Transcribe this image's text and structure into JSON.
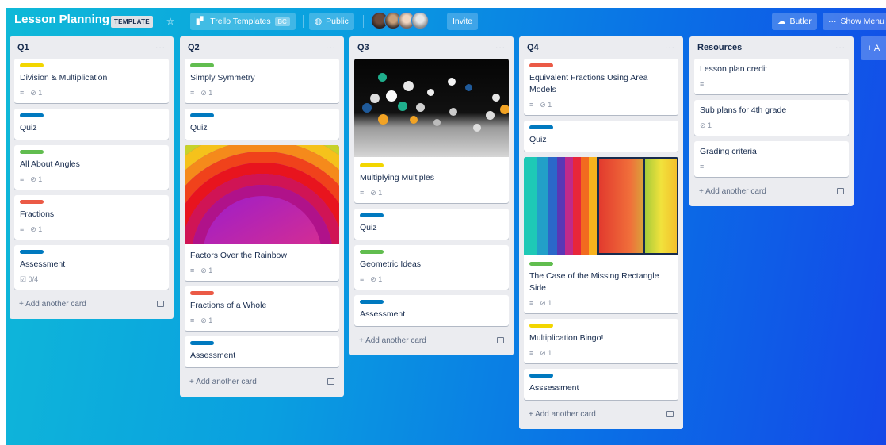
{
  "board": {
    "title": "Lesson Planning",
    "template_badge": "TEMPLATE",
    "workspace_label": "Trello Templates",
    "workspace_badge": "BC",
    "visibility_label": "Public",
    "invite_label": "Invite",
    "butler_label": "Butler",
    "show_menu_label": "Show Menu",
    "add_list_label": "+ A"
  },
  "lists": [
    {
      "title": "Q1",
      "menu": "···",
      "add_card": "+ Add another card",
      "cards": [
        {
          "label_color": "#f2d600",
          "title": "Division & Multiplication",
          "desc": "≡",
          "attach": "⊘ 1"
        },
        {
          "label_color": "#0079bf",
          "title": "Quiz"
        },
        {
          "label_color": "#61bd4f",
          "title": "All About Angles",
          "desc": "≡",
          "attach": "⊘ 1"
        },
        {
          "label_color": "#eb5a46",
          "title": "Fractions",
          "desc": "≡",
          "attach": "⊘ 1"
        },
        {
          "label_color": "#0079bf",
          "title": "Assessment",
          "checklist": "☑ 0/4"
        }
      ]
    },
    {
      "title": "Q2",
      "menu": "···",
      "add_card": "+ Add another card",
      "cards": [
        {
          "label_color": "#61bd4f",
          "title": "Simply Symmetry",
          "desc": "≡",
          "attach": "⊘ 1"
        },
        {
          "label_color": "#0079bf",
          "title": "Quiz"
        },
        {
          "title": "Factors Over the Rainbow",
          "desc": "≡",
          "attach": "⊘ 1"
        },
        {
          "label_color": "#eb5a46",
          "title": "Fractions of a Whole",
          "desc": "≡",
          "attach": "⊘ 1"
        },
        {
          "label_color": "#0079bf",
          "title": "Assessment"
        }
      ]
    },
    {
      "title": "Q3",
      "menu": "···",
      "add_card": "+ Add another card",
      "cards": [
        {
          "label_color": "#f2d600",
          "title": "Multiplying Multiples",
          "desc": "≡",
          "attach": "⊘ 1"
        },
        {
          "label_color": "#0079bf",
          "title": "Quiz"
        },
        {
          "label_color": "#61bd4f",
          "title": "Geometric Ideas",
          "desc": "≡",
          "attach": "⊘ 1"
        },
        {
          "label_color": "#0079bf",
          "title": "Assessment"
        }
      ]
    },
    {
      "title": "Q4",
      "menu": "···",
      "add_card": "+ Add another card",
      "cards": [
        {
          "label_color": "#eb5a46",
          "title": "Equivalent Fractions Using Area Models",
          "desc": "≡",
          "attach": "⊘ 1"
        },
        {
          "label_color": "#0079bf",
          "title": "Quiz"
        },
        {
          "label_color": "#61bd4f",
          "title": "The Case of the Missing Rectangle Side",
          "desc": "≡",
          "attach": "⊘ 1"
        },
        {
          "label_color": "#f2d600",
          "title": "Multiplication Bingo!",
          "desc": "≡",
          "attach": "⊘ 1"
        },
        {
          "label_color": "#0079bf",
          "title": "Asssessment"
        }
      ]
    },
    {
      "title": "Resources",
      "menu": "···",
      "add_card": "+ Add another card",
      "cards": [
        {
          "title": "Lesson plan credit",
          "desc": "≡"
        },
        {
          "title": "Sub plans for 4th grade",
          "attach": "⊘ 1"
        },
        {
          "title": "Grading criteria",
          "desc": "≡"
        }
      ]
    }
  ]
}
